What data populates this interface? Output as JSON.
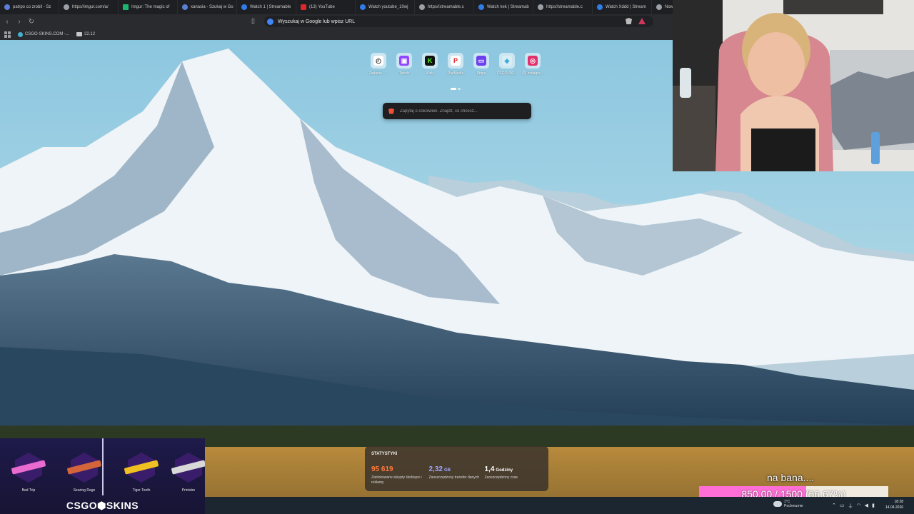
{
  "tabs": [
    {
      "label": "patrpo co zrobil - Sz",
      "icon": "google-icon"
    },
    {
      "label": "https//imgur.com/a/",
      "icon": "globe-icon"
    },
    {
      "label": "Imgur: The magic of",
      "icon": "imgur-icon"
    },
    {
      "label": "xanasia - Szukaj w Go",
      "icon": "google-icon"
    },
    {
      "label": "Watch 1 | Streamable",
      "icon": "streamable-icon"
    },
    {
      "label": "(13) YouTube",
      "icon": "youtube-icon"
    },
    {
      "label": "Watch youtube_10wj",
      "icon": "streamable-icon"
    },
    {
      "label": "https//streamable.c",
      "icon": "globe-icon"
    },
    {
      "label": "Watch kek | Streamab",
      "icon": "streamable-icon"
    },
    {
      "label": "https//streamable.c",
      "icon": "globe-icon"
    },
    {
      "label": "Watch Xddd | Stream",
      "icon": "streamable-icon"
    },
    {
      "label": "Now",
      "icon": "brave-icon"
    }
  ],
  "address_bar": {
    "placeholder": "Wyszukaj w Google lub wpisz URL"
  },
  "bookmarks": [
    {
      "label": "CSGO-SKINS.COM -...",
      "icon": "csgo-site-icon"
    },
    {
      "label": "22.12",
      "icon": "folder-icon"
    }
  ],
  "shortcuts": [
    {
      "label": "Zadanie - ...",
      "icon": "zadanie-icon",
      "color": "#ffffff",
      "glyph": "◴",
      "glyph_color": "#333333"
    },
    {
      "label": "Twitch",
      "icon": "twitch-icon",
      "color": "#9146ff",
      "glyph": "▣",
      "glyph_color": "#ffffff"
    },
    {
      "label": "Kick",
      "icon": "kick-icon",
      "color": "#111111",
      "glyph": "K",
      "glyph_color": "#53fc18"
    },
    {
      "label": "PayMedia",
      "icon": "paymedia-icon",
      "color": "#ffffff",
      "glyph": "P",
      "glyph_color": "#e0282a"
    },
    {
      "label": "Stripe",
      "icon": "stripe-icon",
      "color": "#6c3ff0",
      "glyph": "▭",
      "glyph_color": "#ffffff"
    },
    {
      "label": "CSGO-SKI...",
      "icon": "csgo-site-icon",
      "color": "#d8eef6",
      "glyph": "◈",
      "glyph_color": "#39a9d8"
    },
    {
      "label": "(9) Instagra...",
      "icon": "instagram-icon",
      "color": "#e1306c",
      "glyph": "◎",
      "glyph_color": "#ffffff"
    }
  ],
  "search": {
    "placeholder": "Zapytaj o cokolwiek. Znajdź, co chcesz..."
  },
  "stats": {
    "title": "STATYSTYKI",
    "items": [
      {
        "value": "95 619",
        "unit": "",
        "color": "#ff7a3c",
        "desc": "Zablokowane skrypty śledzące i reklamy"
      },
      {
        "value": "2,32",
        "unit": "GB",
        "color": "#9fa6ff",
        "desc": "Zaoszczędzony transfer danych"
      },
      {
        "value": "1,4",
        "unit": "Godziny",
        "color": "#ffffff",
        "desc": "Zaoszczędzony czas"
      }
    ]
  },
  "csgo_widget": {
    "logo": "CSGO⬢SKINS",
    "skins": [
      {
        "name": "Bad Trip",
        "color": "#e96bd0"
      },
      {
        "name": "Searing Rage",
        "color": "#d4643a"
      },
      {
        "name": "Tiger Tooth",
        "color": "#f0c020"
      },
      {
        "name": "Printstre",
        "color": "#d8d8d8"
      }
    ]
  },
  "goal": {
    "text": "na bana....",
    "label": "850.00 / 1500 (56.67%)",
    "current": 850,
    "target": 1500,
    "progress": 0.5667
  },
  "weather": {
    "temp": "1°C",
    "desc": "Pochmurnie"
  },
  "clock": {
    "time": "18:28",
    "date": "14.04.2026"
  }
}
